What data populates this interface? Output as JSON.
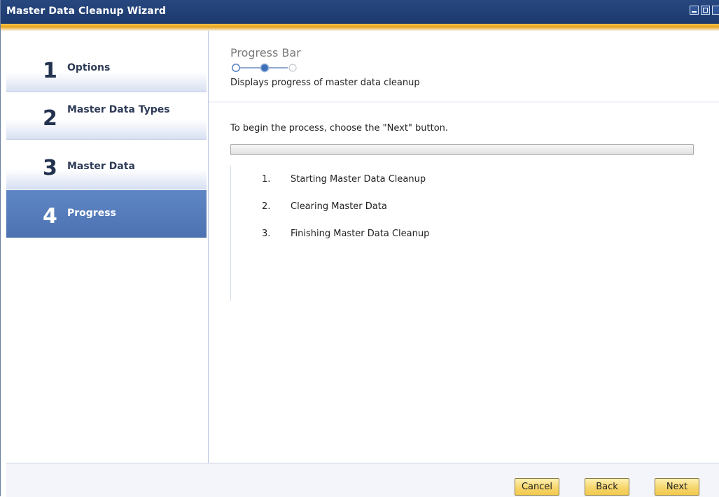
{
  "window": {
    "title": "Master Data Cleanup Wizard"
  },
  "steps": [
    {
      "number": "1",
      "label": "Options",
      "active": false
    },
    {
      "number": "2",
      "label": "Master Data Types",
      "active": false
    },
    {
      "number": "3",
      "label": "Master Data",
      "active": false
    },
    {
      "number": "4",
      "label": "Progress",
      "active": true
    }
  ],
  "page": {
    "title": "Progress Bar",
    "description": "Displays progress of master data cleanup",
    "wizard_position": {
      "current": 2,
      "total": 3
    }
  },
  "content": {
    "instruction": "To begin the process, choose the \"Next\" button.",
    "progress_fraction": 0,
    "tasks": [
      {
        "index": "1.",
        "label": "Starting Master Data Cleanup"
      },
      {
        "index": "2.",
        "label": "Clearing Master Data"
      },
      {
        "index": "3.",
        "label": "Finishing Master Data Cleanup"
      }
    ]
  },
  "footer": {
    "cancel_label": "Cancel",
    "back_label": "Back",
    "next_label": "Next"
  },
  "colors": {
    "title_bar": "#1d3a6d",
    "accent": "#f2c94c",
    "active_step": "#5077b6"
  }
}
